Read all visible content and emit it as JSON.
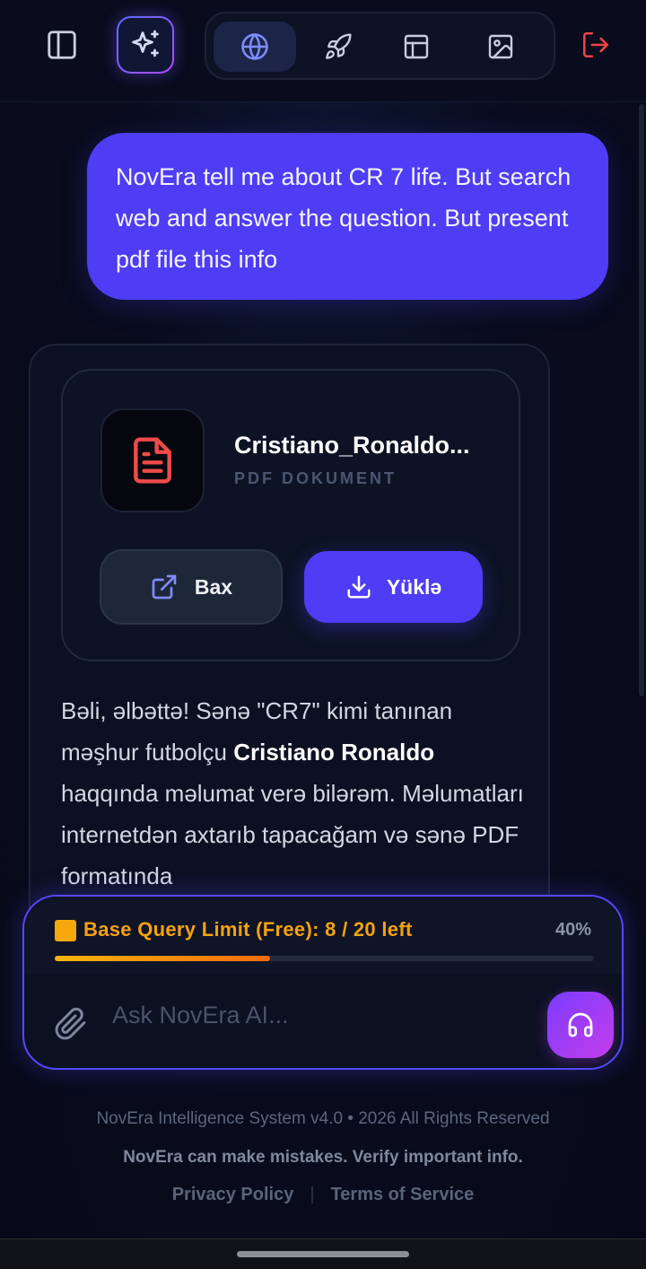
{
  "topbar": {
    "icons": {
      "sidebar": "sidebar-icon",
      "sparkle": "sparkles-icon",
      "globe": "globe-icon",
      "rocket": "rocket-icon",
      "layout": "layout-icon",
      "image": "image-icon",
      "logout": "logout-icon"
    },
    "colors": {
      "accent": "#4f3cf5",
      "logout": "#ef4444",
      "icon": "#c9cede"
    }
  },
  "chat": {
    "user_message": "NovEra tell me about CR 7 life. But search web and answer the question. But present pdf file this info",
    "attachment": {
      "file_name": "Cristiano_Ronaldo...",
      "file_type": "PDF DOKUMENT",
      "view_label": "Bax",
      "download_label": "Yüklə",
      "icon": "file-text-icon"
    },
    "answer": {
      "part1": "Bəli, əlbəttə! Sənə \"CR7\" kimi tanınan məşhur futbolçu ",
      "bold": "Cristiano Ronaldo",
      "part2": " haqqında məlumat verə bilərəm. Məlumatları internetdən axtarıb tapacağam və sənə PDF formatında"
    }
  },
  "composer": {
    "limit_text": "Base Query Limit (Free): 8 / 20 left",
    "limit_percent_label": "40%",
    "limit_fraction": 0.4,
    "limit_color": "#f5a20f",
    "placeholder": "Ask NovEra AI...",
    "attach_icon": "paperclip-icon",
    "voice_icon": "headphones-icon"
  },
  "footer": {
    "copyright": "NovEra Intelligence System v4.0 • 2026 All Rights Reserved",
    "disclaimer": "NovEra can make mistakes. Verify important info.",
    "privacy": "Privacy Policy",
    "separator": "|",
    "terms": "Terms of Service"
  }
}
